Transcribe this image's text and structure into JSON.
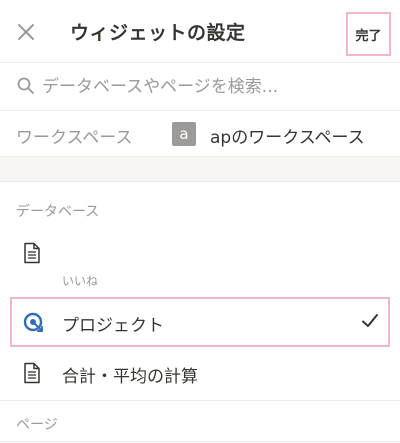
{
  "header": {
    "title": "ウィジェットの設定",
    "done_label": "完了",
    "close_icon": "close-icon"
  },
  "search": {
    "placeholder": "データベースやページを検索..."
  },
  "workspace": {
    "label": "ワークスペース",
    "avatar_letter": "a",
    "name": "apのワークスペース"
  },
  "sections": {
    "database_header": "データベース",
    "page_header": "ページ"
  },
  "items": [
    {
      "label": "",
      "sublabel": "いいね",
      "icon": "document-icon",
      "selected": false
    },
    {
      "label": "プロジェクト",
      "sublabel": "",
      "icon": "target-icon",
      "selected": true
    },
    {
      "label": "合計・平均の計算",
      "sublabel": "",
      "icon": "document-icon",
      "selected": false
    }
  ],
  "colors": {
    "accent_highlight": "#f3b4cf",
    "muted_text": "#9b9a97",
    "main_text": "#37352f",
    "project_icon": "#2f6fb8"
  }
}
